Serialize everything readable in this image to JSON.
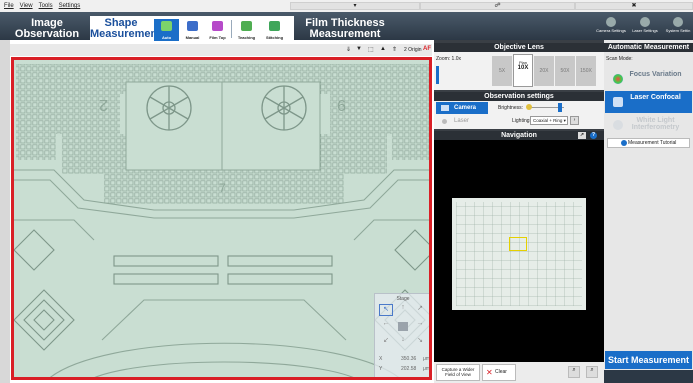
{
  "menu": [
    "File",
    "View",
    "Tools",
    "Settings"
  ],
  "tabs": {
    "image_observation": [
      "Image",
      "Observation"
    ],
    "shape_measurement": [
      "Shape",
      "Measurement"
    ],
    "film_thickness": [
      "Film Thickness",
      "Measurement"
    ]
  },
  "subtools": [
    "Auto",
    "Manual",
    "Film Top",
    "Teaching",
    "Stitching"
  ],
  "right_tools": [
    "Camera Settings",
    "Laser Settings",
    "System Settin"
  ],
  "view_toolbar": {
    "zoom": "2 Origin",
    "af": "AF"
  },
  "objective": {
    "title": "Objective Lens",
    "zoom_label": "Zoom: 1.0x",
    "lenses": [
      "5X",
      "10X",
      "20X",
      "50X",
      "150X"
    ],
    "selected": "10X",
    "selected_detail": "Plan"
  },
  "obs": {
    "title": "Observation settings",
    "camera": "Camera",
    "laser": "Laser",
    "brightness": "Brightness:",
    "lighting": "Lighting:",
    "lighting_value": "Coaxial + Ring"
  },
  "nav": {
    "title": "Navigation",
    "capture": "Capture a Wider Field of View",
    "clear": "Clear"
  },
  "auto": {
    "title": "Automatic Measurement",
    "scan_mode": "Scan Mode:",
    "modes": [
      "Focus Variation",
      "Laser Confocal",
      "White Light Interferometry"
    ],
    "tutorial": "Measurement Tutorial",
    "start": "Start Measurement"
  },
  "stage_widget": {
    "title": "Stage",
    "x_label": "X",
    "y_label": "Y",
    "x_value": "350.36",
    "y_value": "202.58",
    "unit": "μm"
  },
  "image_labels": {
    "left": "2",
    "right": "9",
    "bottom": "7"
  },
  "colors": {
    "accent": "#1a6ec8",
    "highlight": "#d91f26",
    "panel": "#3a3f45"
  }
}
